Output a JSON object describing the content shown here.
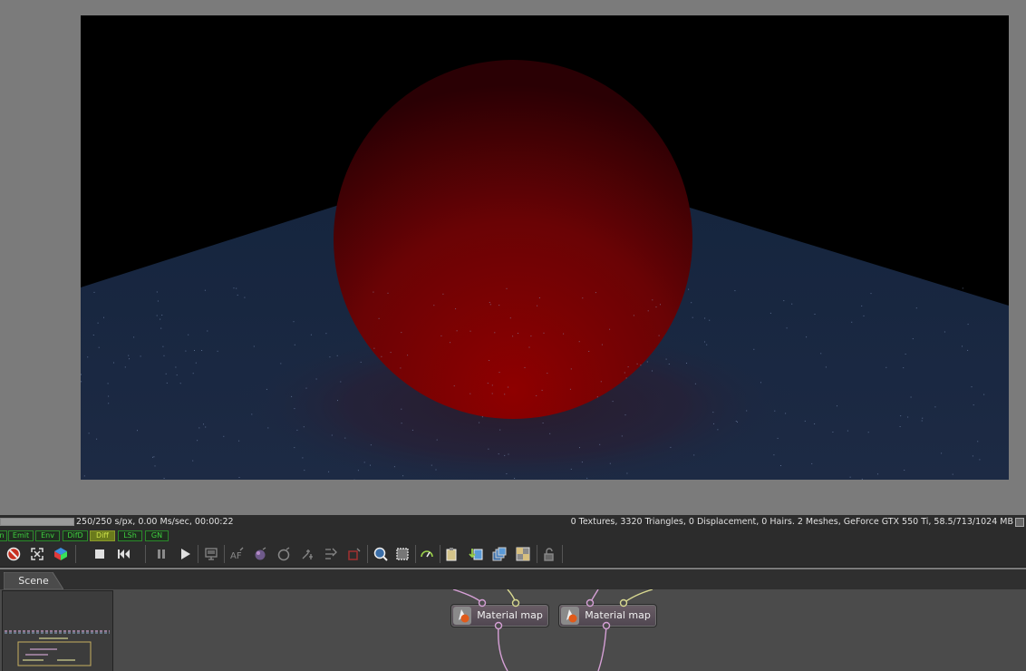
{
  "status": {
    "progress_percent": 100,
    "left_text": "250/250 s/px, 0.00 Ms/sec, 00:00:22",
    "right_text": "0 Textures, 3320 Triangles, 0 Displacement, 0 Hairs. 2 Meshes, GeForce GTX 550 Ti, 58.5/713/1024 MB"
  },
  "passes": [
    {
      "label": "n",
      "active": false
    },
    {
      "label": "Emit",
      "active": false
    },
    {
      "label": "Env",
      "active": false
    },
    {
      "label": "DifD",
      "active": false
    },
    {
      "label": "Diff",
      "active": true
    },
    {
      "label": "LSh",
      "active": false
    },
    {
      "label": "GN",
      "active": false
    }
  ],
  "toolbar_icons": [
    "clear-render-icon",
    "fit-view-icon",
    "color-cube-icon",
    "stop-icon",
    "restart-icon",
    "pause-icon",
    "play-icon",
    "monitor-icon",
    "autofocus-icon",
    "material-picker-icon",
    "object-picker-icon",
    "focus-picker-icon",
    "white-balance-icon",
    "region-icon",
    "zoom-icon",
    "render-region-icon",
    "priority-icon",
    "copy-clipboard-icon",
    "save-image-icon",
    "render-passes-icon",
    "clay-mode-icon",
    "lock-icon"
  ],
  "tabs": {
    "scene": "Scene"
  },
  "nodes": [
    {
      "label": "Material map"
    },
    {
      "label": "Material map"
    }
  ],
  "colors": {
    "sphere": "#8a0000",
    "floor": "#1a2b44",
    "pass_active": "#6a7a1c",
    "pass_text": "#3fd23f"
  }
}
